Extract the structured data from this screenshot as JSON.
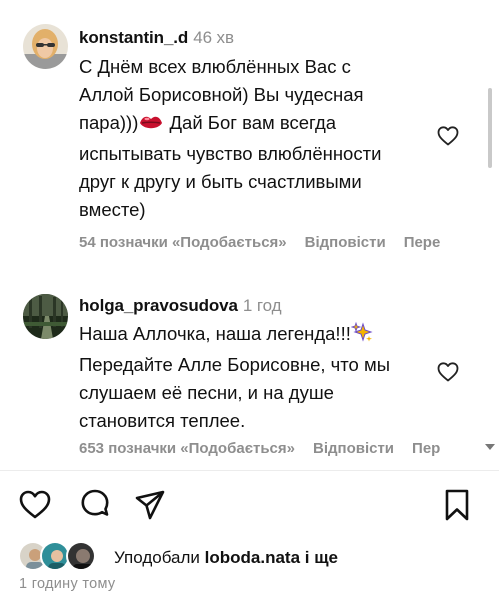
{
  "comments": [
    {
      "username": "konstantin_.d",
      "time": "46 хв",
      "lines": [
        "С Днём всех влюблённых Вас с",
        "Аллой Борисовной) Вы чудесная",
        "пара)))",
        " Дай Бог вам всегда",
        "испытывать чувство влюблённости",
        "друг к другу и быть счастливыми",
        "вместе)"
      ],
      "emoji": "lips-emoji",
      "likes": "54 позначки «Подобається»",
      "reply": "Відповісти",
      "translate": "Пере"
    },
    {
      "username": "holga_pravosudova",
      "time": "1 год",
      "lines": [
        "Наша Аллочка, наша легенда!!!",
        "Передайте Алле Борисовне, что мы",
        "слушаем её песни, и на душе",
        "становится теплее."
      ],
      "emoji": "sparkles-emoji",
      "likes": "653 позначки «Подобається»",
      "reply": "Відповісти",
      "translate": "Пер"
    }
  ],
  "actions": {
    "icons": [
      "heart-icon",
      "comment-icon",
      "share-icon",
      "bookmark-icon"
    ]
  },
  "liked_by": {
    "prefix": "Уподобали ",
    "user": "loboda.nata",
    "suffix": " і ще"
  },
  "posted_ago": "1 годину тому",
  "colors": {
    "text": "#111111",
    "muted": "#8e8e8e",
    "lips": "#c8102e"
  }
}
